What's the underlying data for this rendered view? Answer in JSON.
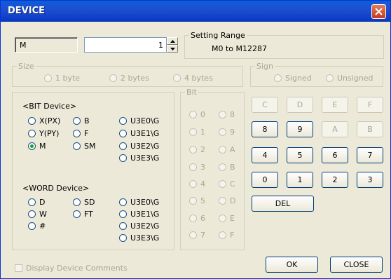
{
  "window": {
    "title": "DEVICE"
  },
  "device": {
    "name": "M",
    "number": "1"
  },
  "setting_range": {
    "label": "Setting Range",
    "value": "M0 to M12287"
  },
  "size": {
    "label": "Size",
    "options": [
      "1 byte",
      "2 bytes",
      "4 bytes"
    ]
  },
  "sign": {
    "label": "Sign",
    "options": [
      "Signed",
      "Unsigned"
    ]
  },
  "bit_device": {
    "header": "<BIT Device>",
    "options": [
      "X(PX)",
      "B",
      "U3E0\\G",
      "Y(PY)",
      "F",
      "U3E1\\G",
      "M",
      "SM",
      "U3E2\\G",
      "U3E3\\G"
    ],
    "selected": "M"
  },
  "word_device": {
    "header": "<WORD Device>",
    "options": [
      "D",
      "SD",
      "U3E0\\G",
      "W",
      "FT",
      "U3E1\\G",
      "#",
      "U3E2\\G",
      "U3E3\\G"
    ]
  },
  "bit": {
    "label": "Bit",
    "options": [
      "0",
      "8",
      "1",
      "9",
      "2",
      "A",
      "3",
      "B",
      "4",
      "C",
      "5",
      "D",
      "6",
      "E",
      "7",
      "F"
    ]
  },
  "keypad": {
    "keys": [
      "C",
      "D",
      "E",
      "F",
      "8",
      "9",
      "A",
      "B",
      "4",
      "5",
      "6",
      "7",
      "0",
      "1",
      "2",
      "3"
    ],
    "del": "DEL"
  },
  "comments": {
    "label": "Display Device Comments"
  },
  "buttons": {
    "ok": "OK",
    "close": "CLOSE"
  }
}
